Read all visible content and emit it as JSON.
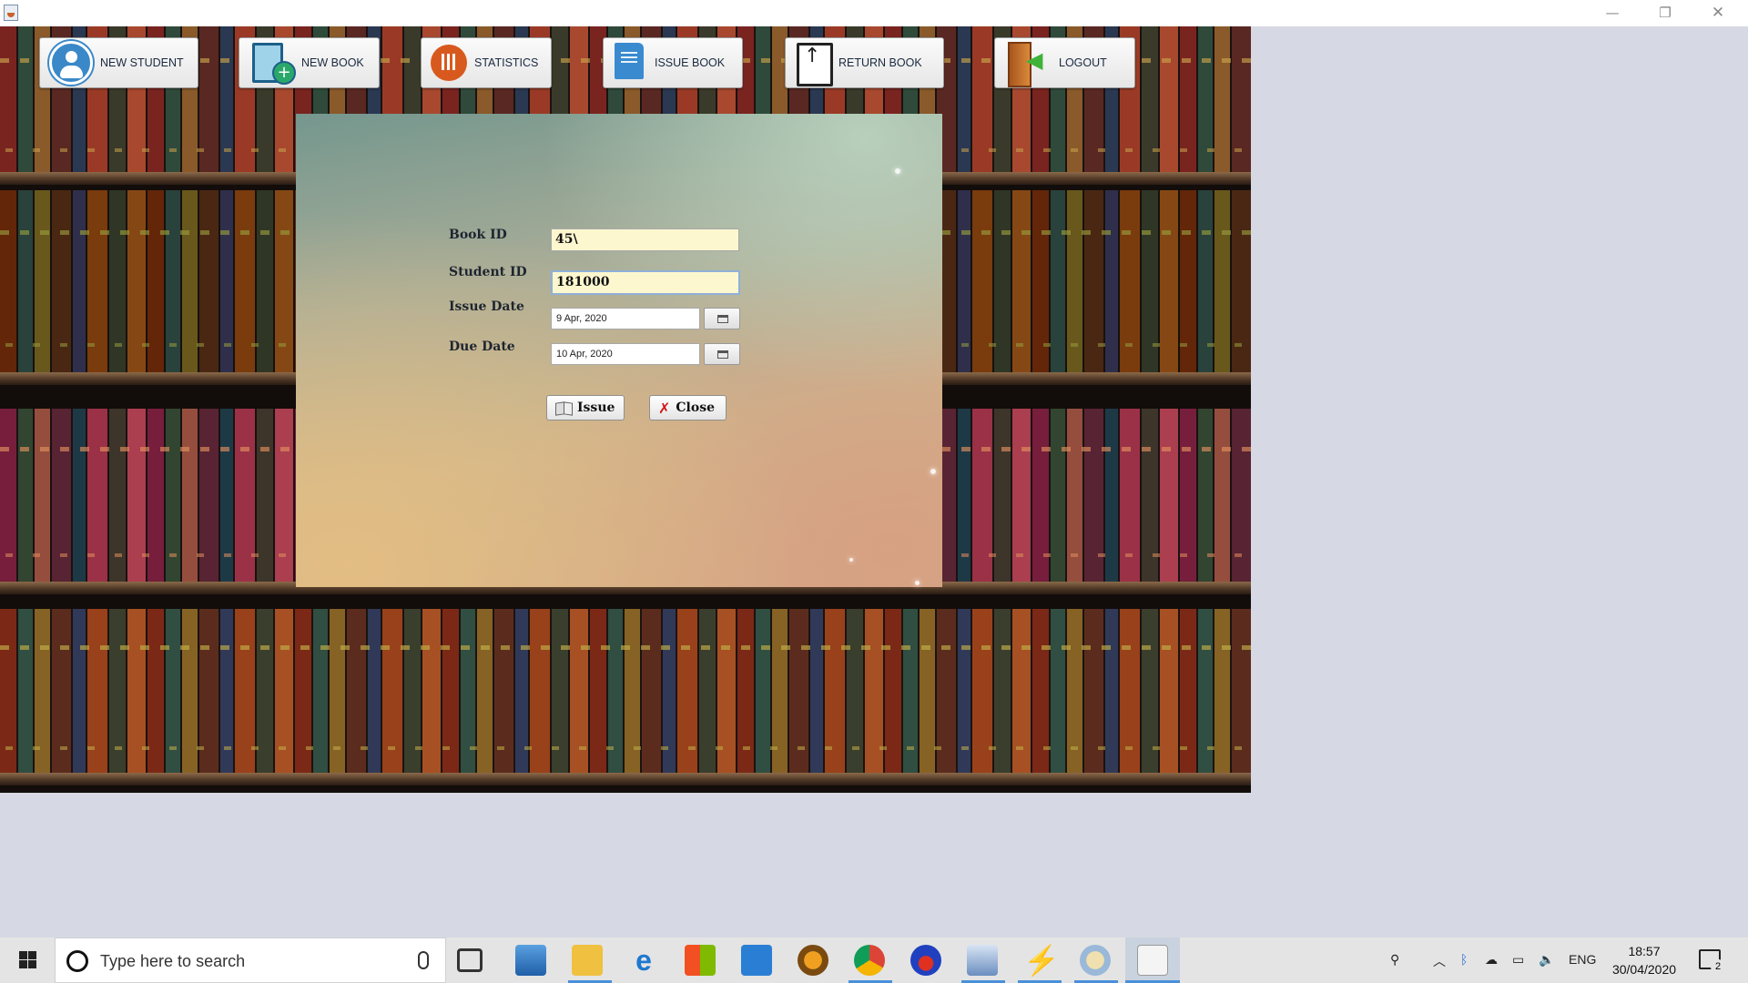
{
  "window": {
    "title": "",
    "controls": [
      "minimize",
      "restore",
      "close"
    ]
  },
  "toolbar": {
    "new_student": "NEW STUDENT",
    "new_book": "NEW BOOK",
    "statistics": "STATISTICS",
    "issue_book": "ISSUE BOOK",
    "return_book": "RETURN BOOK",
    "logout": "LOGOUT"
  },
  "form": {
    "book_id_label": "Book ID",
    "book_id_value": "45\\",
    "student_id_label": "Student ID",
    "student_id_value": "181000",
    "issue_date_label": "Issue Date",
    "issue_date_value": "9 Apr, 2020",
    "due_date_label": "Due Date",
    "due_date_value": "10 Apr, 2020",
    "issue_button": "Issue",
    "close_button": "Close"
  },
  "taskbar": {
    "search_placeholder": "Type here to search",
    "language": "ENG",
    "time": "18:57",
    "date": "30/04/2020",
    "notification_count": "2",
    "pinned_apps": [
      "task-view",
      "desktop-app",
      "file-explorer",
      "edge",
      "store",
      "mail",
      "fl-studio",
      "chrome",
      "app-blue-red",
      "virtualbox",
      "winamp",
      "paint",
      "java"
    ]
  },
  "colors": {
    "panel_top": "#75978e",
    "panel_bottom": "#d3aa8a",
    "input_bg": "#fdf7cf",
    "taskbar_bg": "#e4e4e4",
    "accent": "#4a90d9"
  }
}
